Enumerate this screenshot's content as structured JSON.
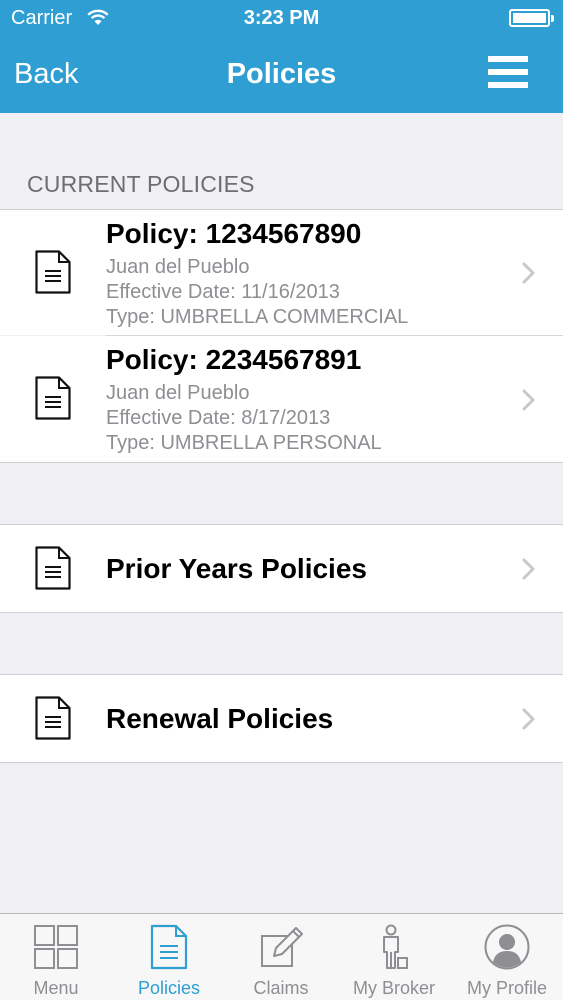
{
  "status_bar": {
    "carrier": "Carrier",
    "time": "3:23 PM",
    "wifi_icon": "wifi-icon",
    "battery_icon": "battery-icon"
  },
  "nav": {
    "back_label": "Back",
    "title": "Policies",
    "menu_icon": "hamburger-menu-icon"
  },
  "current_policies": {
    "header": "CURRENT POLICIES",
    "items": [
      {
        "title": "Policy: 1234567890",
        "holder": "Juan del Pueblo",
        "effective": "Effective Date: 11/16/2013",
        "type": "Type: UMBRELLA COMMERCIAL"
      },
      {
        "title": "Policy: 2234567891",
        "holder": "Juan del Pueblo",
        "effective": "Effective Date: 8/17/2013",
        "type": "Type: UMBRELLA PERSONAL"
      }
    ]
  },
  "prior_years": {
    "label": "Prior Years Policies"
  },
  "renewal": {
    "label": "Renewal Policies"
  },
  "tabs": [
    {
      "label": "Menu",
      "icon": "grid-icon",
      "active": false
    },
    {
      "label": "Policies",
      "icon": "document-icon",
      "active": true
    },
    {
      "label": "Claims",
      "icon": "edit-icon",
      "active": false
    },
    {
      "label": "My Broker",
      "icon": "person-briefcase-icon",
      "active": false
    },
    {
      "label": "My Profile",
      "icon": "profile-avatar-icon",
      "active": false
    }
  ],
  "colors": {
    "accent": "#2f9fd3",
    "background": "#efeff4",
    "secondary_text": "#8e8e93"
  }
}
